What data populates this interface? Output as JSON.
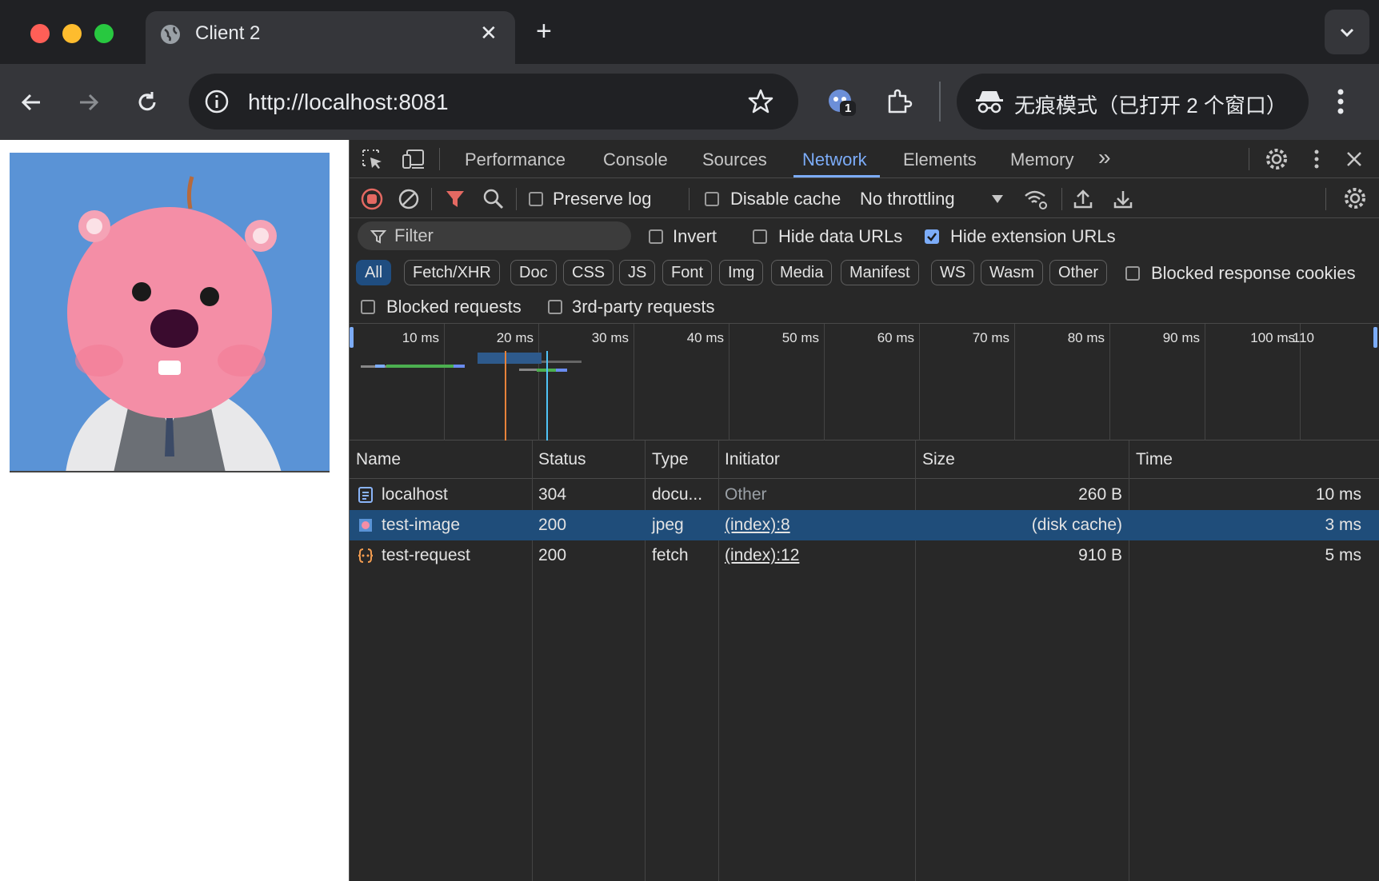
{
  "browser": {
    "tab_title": "Client 2",
    "tab_close": "✕",
    "new_tab": "+",
    "url": "http://localhost:8081",
    "incognito_label": "无痕模式（已打开 2 个窗口）",
    "extension_badge": "1"
  },
  "devtools": {
    "tabs": [
      "Performance",
      "Console",
      "Sources",
      "Network",
      "Elements",
      "Memory"
    ],
    "active_tab": "Network",
    "more_tabs": "»",
    "toolbar": {
      "preserve_log": "Preserve log",
      "preserve_log_checked": false,
      "disable_cache": "Disable cache",
      "disable_cache_checked": false,
      "throttling": "No throttling"
    },
    "filter": {
      "placeholder": "Filter",
      "invert": "Invert",
      "invert_checked": false,
      "hide_data_urls": "Hide data URLs",
      "hide_data_urls_checked": false,
      "hide_extension_urls": "Hide extension URLs",
      "hide_extension_urls_checked": true
    },
    "type_filters": [
      "All",
      "Fetch/XHR",
      "Doc",
      "CSS",
      "JS",
      "Font",
      "Img",
      "Media",
      "Manifest",
      "WS",
      "Wasm",
      "Other"
    ],
    "active_type": "All",
    "blocked_response_cookies": "Blocked response cookies",
    "blocked_requests": "Blocked requests",
    "third_party_requests": "3rd-party requests",
    "timeline_ticks": [
      "10 ms",
      "20 ms",
      "30 ms",
      "40 ms",
      "50 ms",
      "60 ms",
      "70 ms",
      "80 ms",
      "90 ms",
      "100 ms",
      "110"
    ],
    "columns": [
      "Name",
      "Status",
      "Type",
      "Initiator",
      "Size",
      "Time"
    ],
    "requests": [
      {
        "name": "localhost",
        "status": "304",
        "type": "docu...",
        "initiator": "Other",
        "size": "260 B",
        "time": "10 ms",
        "icon": "document-icon",
        "selected": false
      },
      {
        "name": "test-image",
        "status": "200",
        "type": "jpeg",
        "initiator": "(index):8",
        "size": "(disk cache)",
        "time": "3 ms",
        "icon": "image-icon",
        "selected": true
      },
      {
        "name": "test-request",
        "status": "200",
        "type": "fetch",
        "initiator": "(index):12",
        "size": "910 B",
        "time": "5 ms",
        "icon": "fetch-icon",
        "selected": false
      }
    ]
  },
  "colors": {
    "accent": "#7cacf8",
    "selected_row": "#1f4d7a",
    "record": "#e46962"
  }
}
